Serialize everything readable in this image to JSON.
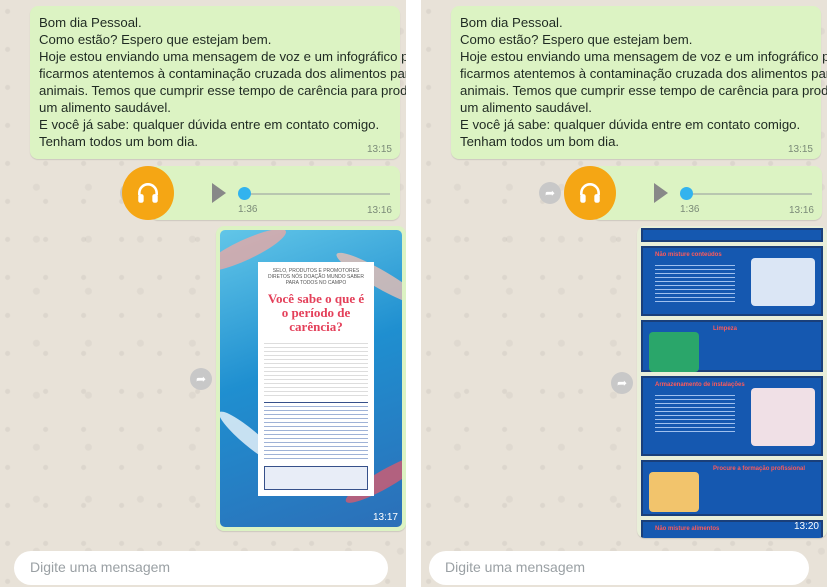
{
  "message_lines": [
    "Bom dia Pessoal.",
    "Como estão? Espero que estejam bem.",
    "Hoje estou enviando uma mensagem de voz e um infográfico para nós",
    "ficarmos atentemos à contaminação cruzada dos alimentos para os",
    "animais. Temos que cumprir esse tempo de carência para produzirmos",
    "um alimento saudável.",
    "E você já sabe: qualquer dúvida entre em contato comigo.",
    "Tenham todos um bom dia."
  ],
  "left": {
    "text_time": "13:15",
    "audio_duration": "1:36",
    "audio_time": "13:16",
    "image_time": "13:17",
    "composer_placeholder": "Digite uma mensagem"
  },
  "right": {
    "text_time": "13:15",
    "audio_duration": "1:36",
    "audio_time": "13:16",
    "image_time": "13:20",
    "composer_placeholder": "Digite uma mensagem"
  },
  "poster": {
    "subtitle": "SELO, PRODUTOS E PROMOTORES DIRETOS NÓS DOAÇÃO MUNDO SABER PARA TODOS NO CAMPO",
    "title": "Você sabe o que é o período de carência?"
  },
  "infographic": {
    "sections": [
      "Não misture conteúdos",
      "Limpeza",
      "Armazenamento de instalações",
      "Procure a formação profissional",
      "Não misture alimentos"
    ]
  },
  "colors": {
    "bubble": "#dcf3c3",
    "avatar": "#f5a614",
    "audio_dot": "#33b3ee"
  }
}
